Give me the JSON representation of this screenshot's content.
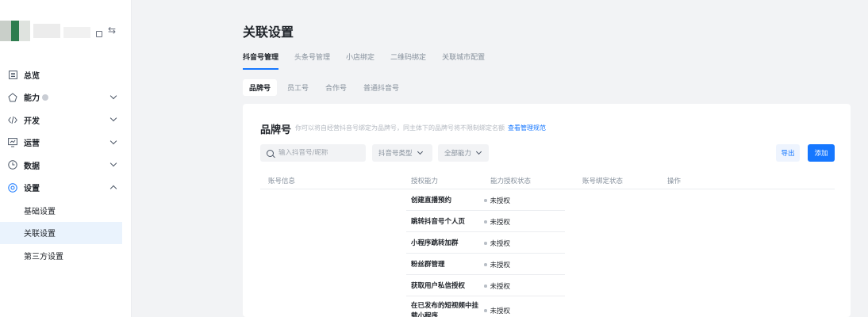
{
  "sidebar": {
    "nav": [
      {
        "label": "总览",
        "icon": "dashboard-icon"
      },
      {
        "label": "能力",
        "icon": "capability-icon"
      },
      {
        "label": "开发",
        "icon": "code-icon"
      },
      {
        "label": "运营",
        "icon": "operation-icon"
      },
      {
        "label": "数据",
        "icon": "data-clock-icon"
      },
      {
        "label": "设置",
        "icon": "settings-icon"
      }
    ],
    "settings_sub": [
      "基础设置",
      "关联设置",
      "第三方设置"
    ]
  },
  "page": {
    "title": "关联设置"
  },
  "tabs": [
    "抖音号管理",
    "头条号管理",
    "小店绑定",
    "二维码绑定",
    "关联城市配置"
  ],
  "subtabs": [
    "品牌号",
    "员工号",
    "合作号",
    "普通抖音号"
  ],
  "card": {
    "title": "品牌号",
    "desc": "你可以将自经营抖音号绑定为品牌号，同主体下的品牌号将不限制绑定名额",
    "link": "查看管理规范",
    "search_placeholder": "输入抖音号/昵称",
    "filter_type": "抖音号类型",
    "filter_cap": "全部能力",
    "export_label": "导出",
    "add_label": "添加"
  },
  "table": {
    "headers": [
      "账号信息",
      "授权能力",
      "能力授权状态",
      "账号绑定状态",
      "操作"
    ],
    "rows": [
      {
        "name": "创建直播预约",
        "status": "未授权"
      },
      {
        "name": "跳转抖音号个人页",
        "status": "未授权"
      },
      {
        "name": "小程序跳转加群",
        "status": "未授权"
      },
      {
        "name": "粉丝群管理",
        "status": "未授权"
      },
      {
        "name": "获取用户私信授权",
        "status": "未授权"
      },
      {
        "name": "在已发布的短视频中挂载小程序",
        "status": "未授权"
      }
    ]
  }
}
